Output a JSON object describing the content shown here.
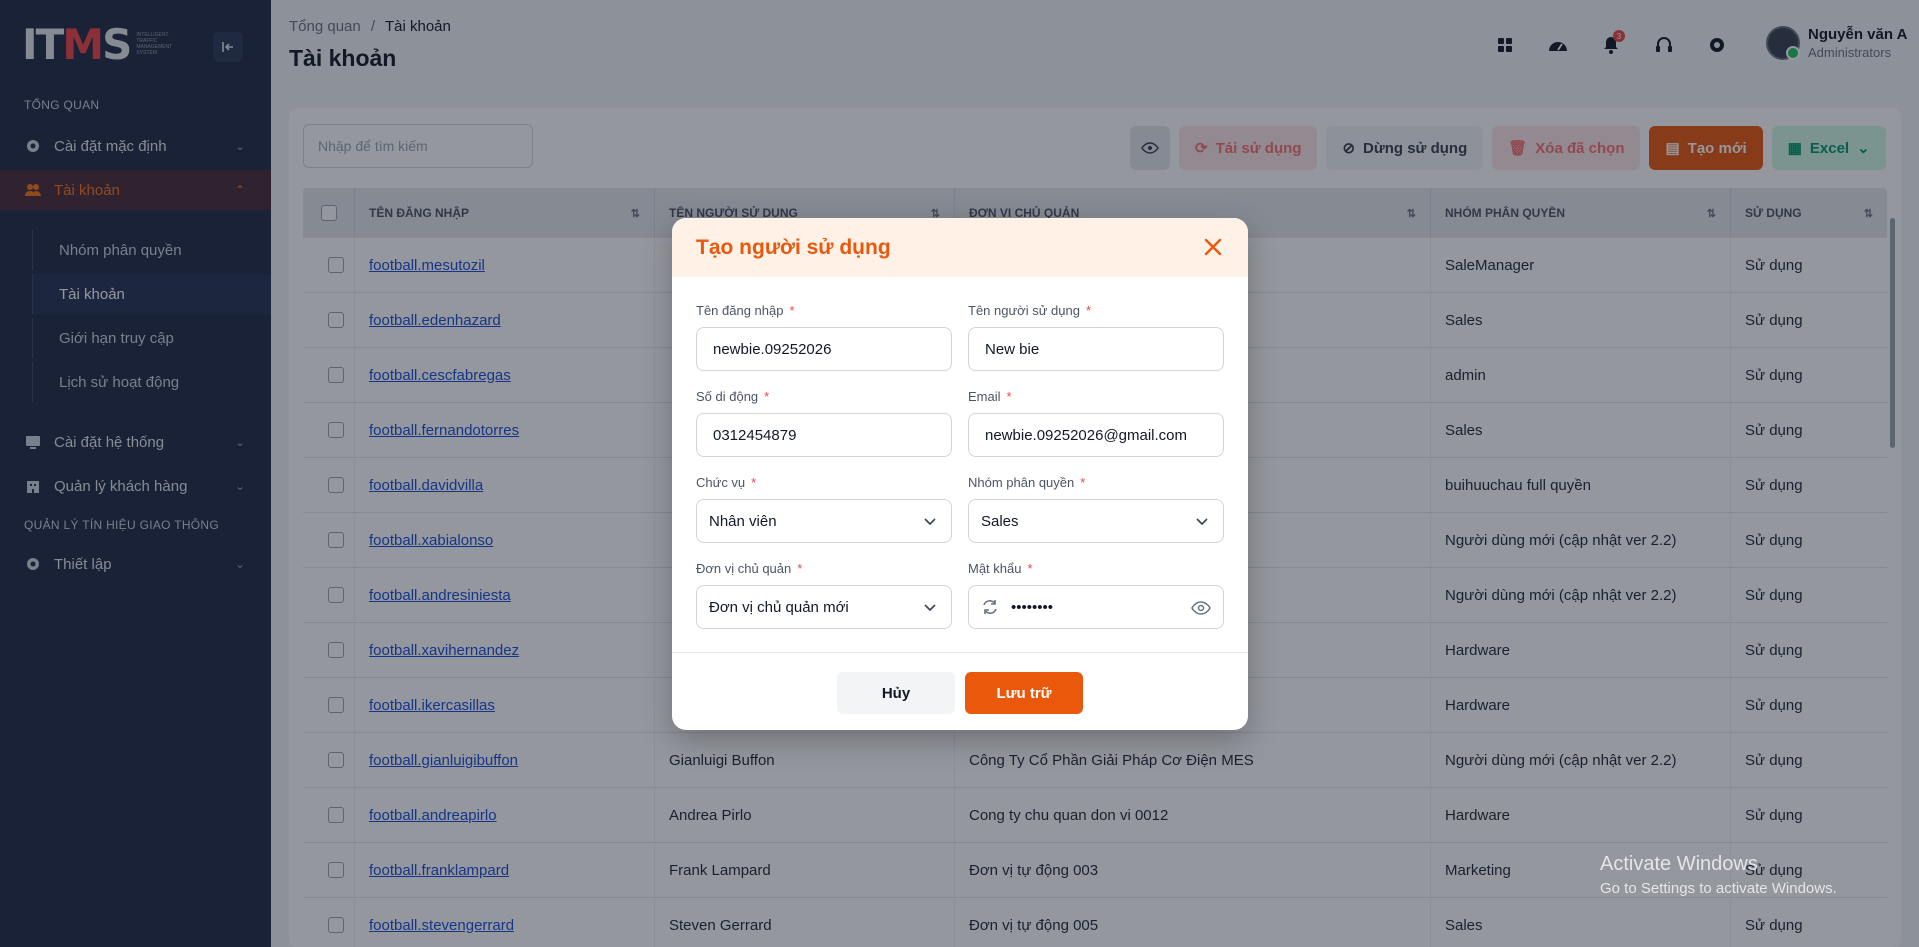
{
  "sidebar": {
    "logo_text": "ITMS",
    "logo_subtitle": "INTELLIGENT TRAFFIC MANAGEMENT SYSTEM",
    "section_overview": "TỔNG QUAN",
    "section_traffic": "QUẢN LÝ TÍN HIỆU GIAO THÔNG",
    "items": [
      {
        "label": "Cài đặt mặc định",
        "icon": "gear-icon"
      },
      {
        "label": "Tài khoản",
        "icon": "users-icon"
      },
      {
        "label": "Cài đặt hệ thống",
        "icon": "monitor-icon"
      },
      {
        "label": "Quản lý khách hàng",
        "icon": "building-icon"
      },
      {
        "label": "Thiết lập",
        "icon": "gear-icon"
      }
    ],
    "sub_items": [
      "Nhóm phân quyền",
      "Tài khoản",
      "Giới hạn truy cập",
      "Lịch sử hoạt động"
    ]
  },
  "header": {
    "breadcrumb_root": "Tổng quan",
    "breadcrumb_sep": "/",
    "breadcrumb_current": "Tài khoản",
    "title": "Tài khoản",
    "notif_count": "3",
    "user_name": "Nguyễn văn A",
    "user_role": "Administrators"
  },
  "toolbar": {
    "search_placeholder": "Nhập để tìm kiếm",
    "reuse": "Tái sử dụng",
    "stop": "Dừng sử dụng",
    "delete": "Xóa đã chọn",
    "create": "Tạo mới",
    "excel": "Excel"
  },
  "table": {
    "headers": [
      "TÊN ĐĂNG NHẬP",
      "TÊN NGƯỜI SỬ DỤNG",
      "ĐƠN VỊ CHỦ QUẢN",
      "NHÓM PHÂN QUYỀN",
      "SỬ DỤNG"
    ],
    "rows": [
      [
        "football.mesutozil",
        "",
        "",
        "SaleManager",
        "Sử dụng"
      ],
      [
        "football.edenhazard",
        "",
        "",
        "Sales",
        "Sử dụng"
      ],
      [
        "football.cescfabregas",
        "",
        "",
        "admin",
        "Sử dụng"
      ],
      [
        "football.fernandotorres",
        "",
        "",
        "Sales",
        "Sử dụng"
      ],
      [
        "football.davidvilla",
        "",
        "",
        "buihuuchau full quyền",
        "Sử dụng"
      ],
      [
        "football.xabialonso",
        "",
        "",
        "Người dùng mới (cập nhật ver 2.2)",
        "Sử dụng"
      ],
      [
        "football.andresiniesta",
        "",
        "",
        "Người dùng mới (cập nhật ver 2.2)",
        "Sử dụng"
      ],
      [
        "football.xavihernandez",
        "",
        "",
        "Hardware",
        "Sử dụng"
      ],
      [
        "football.ikercasillas",
        "",
        "",
        "Hardware",
        "Sử dụng"
      ],
      [
        "football.gianluigibuffon",
        "Gianluigi Buffon",
        "Công Ty Cổ Phần Giải Pháp Cơ Điện MES",
        "Người dùng mới (cập nhật ver 2.2)",
        "Sử dụng"
      ],
      [
        "football.andreapirlo",
        "Andrea Pirlo",
        "Cong ty chu quan don vi 0012",
        "Hardware",
        "Sử dụng"
      ],
      [
        "football.franklampard",
        "Frank Lampard",
        "Đơn vị tự động 003",
        "Marketing",
        "Sử dụng"
      ],
      [
        "football.stevengerrard",
        "Steven Gerrard",
        "Đơn vị tự động 005",
        "Sales",
        "Sử dụng"
      ]
    ]
  },
  "modal": {
    "title": "Tạo người sử dụng",
    "required_mark": "*",
    "username_label": "Tên đăng nhập",
    "username_value": "newbie.09252026",
    "fullname_label": "Tên người sử dụng",
    "fullname_value": "New bie",
    "phone_label": "Số di động",
    "phone_value": "0312454879",
    "email_label": "Email",
    "email_value": "newbie.09252026@gmail.com",
    "position_label": "Chức vụ",
    "position_value": "Nhân viên",
    "group_label": "Nhóm phân quyền",
    "group_value": "Sales",
    "unit_label": "Đơn vị chủ quản",
    "unit_value": "Đơn vị chủ quản mới",
    "password_label": "Mật khẩu",
    "password_value": "••••••••",
    "cancel": "Hủy",
    "save": "Lưu trữ"
  },
  "watermark": {
    "line1": "Activate Windows",
    "line2": "Go to Settings to activate Windows."
  },
  "colors": {
    "accent": "#ea580c",
    "sidebar": "#1f2a44",
    "link": "#1d4ed8"
  }
}
